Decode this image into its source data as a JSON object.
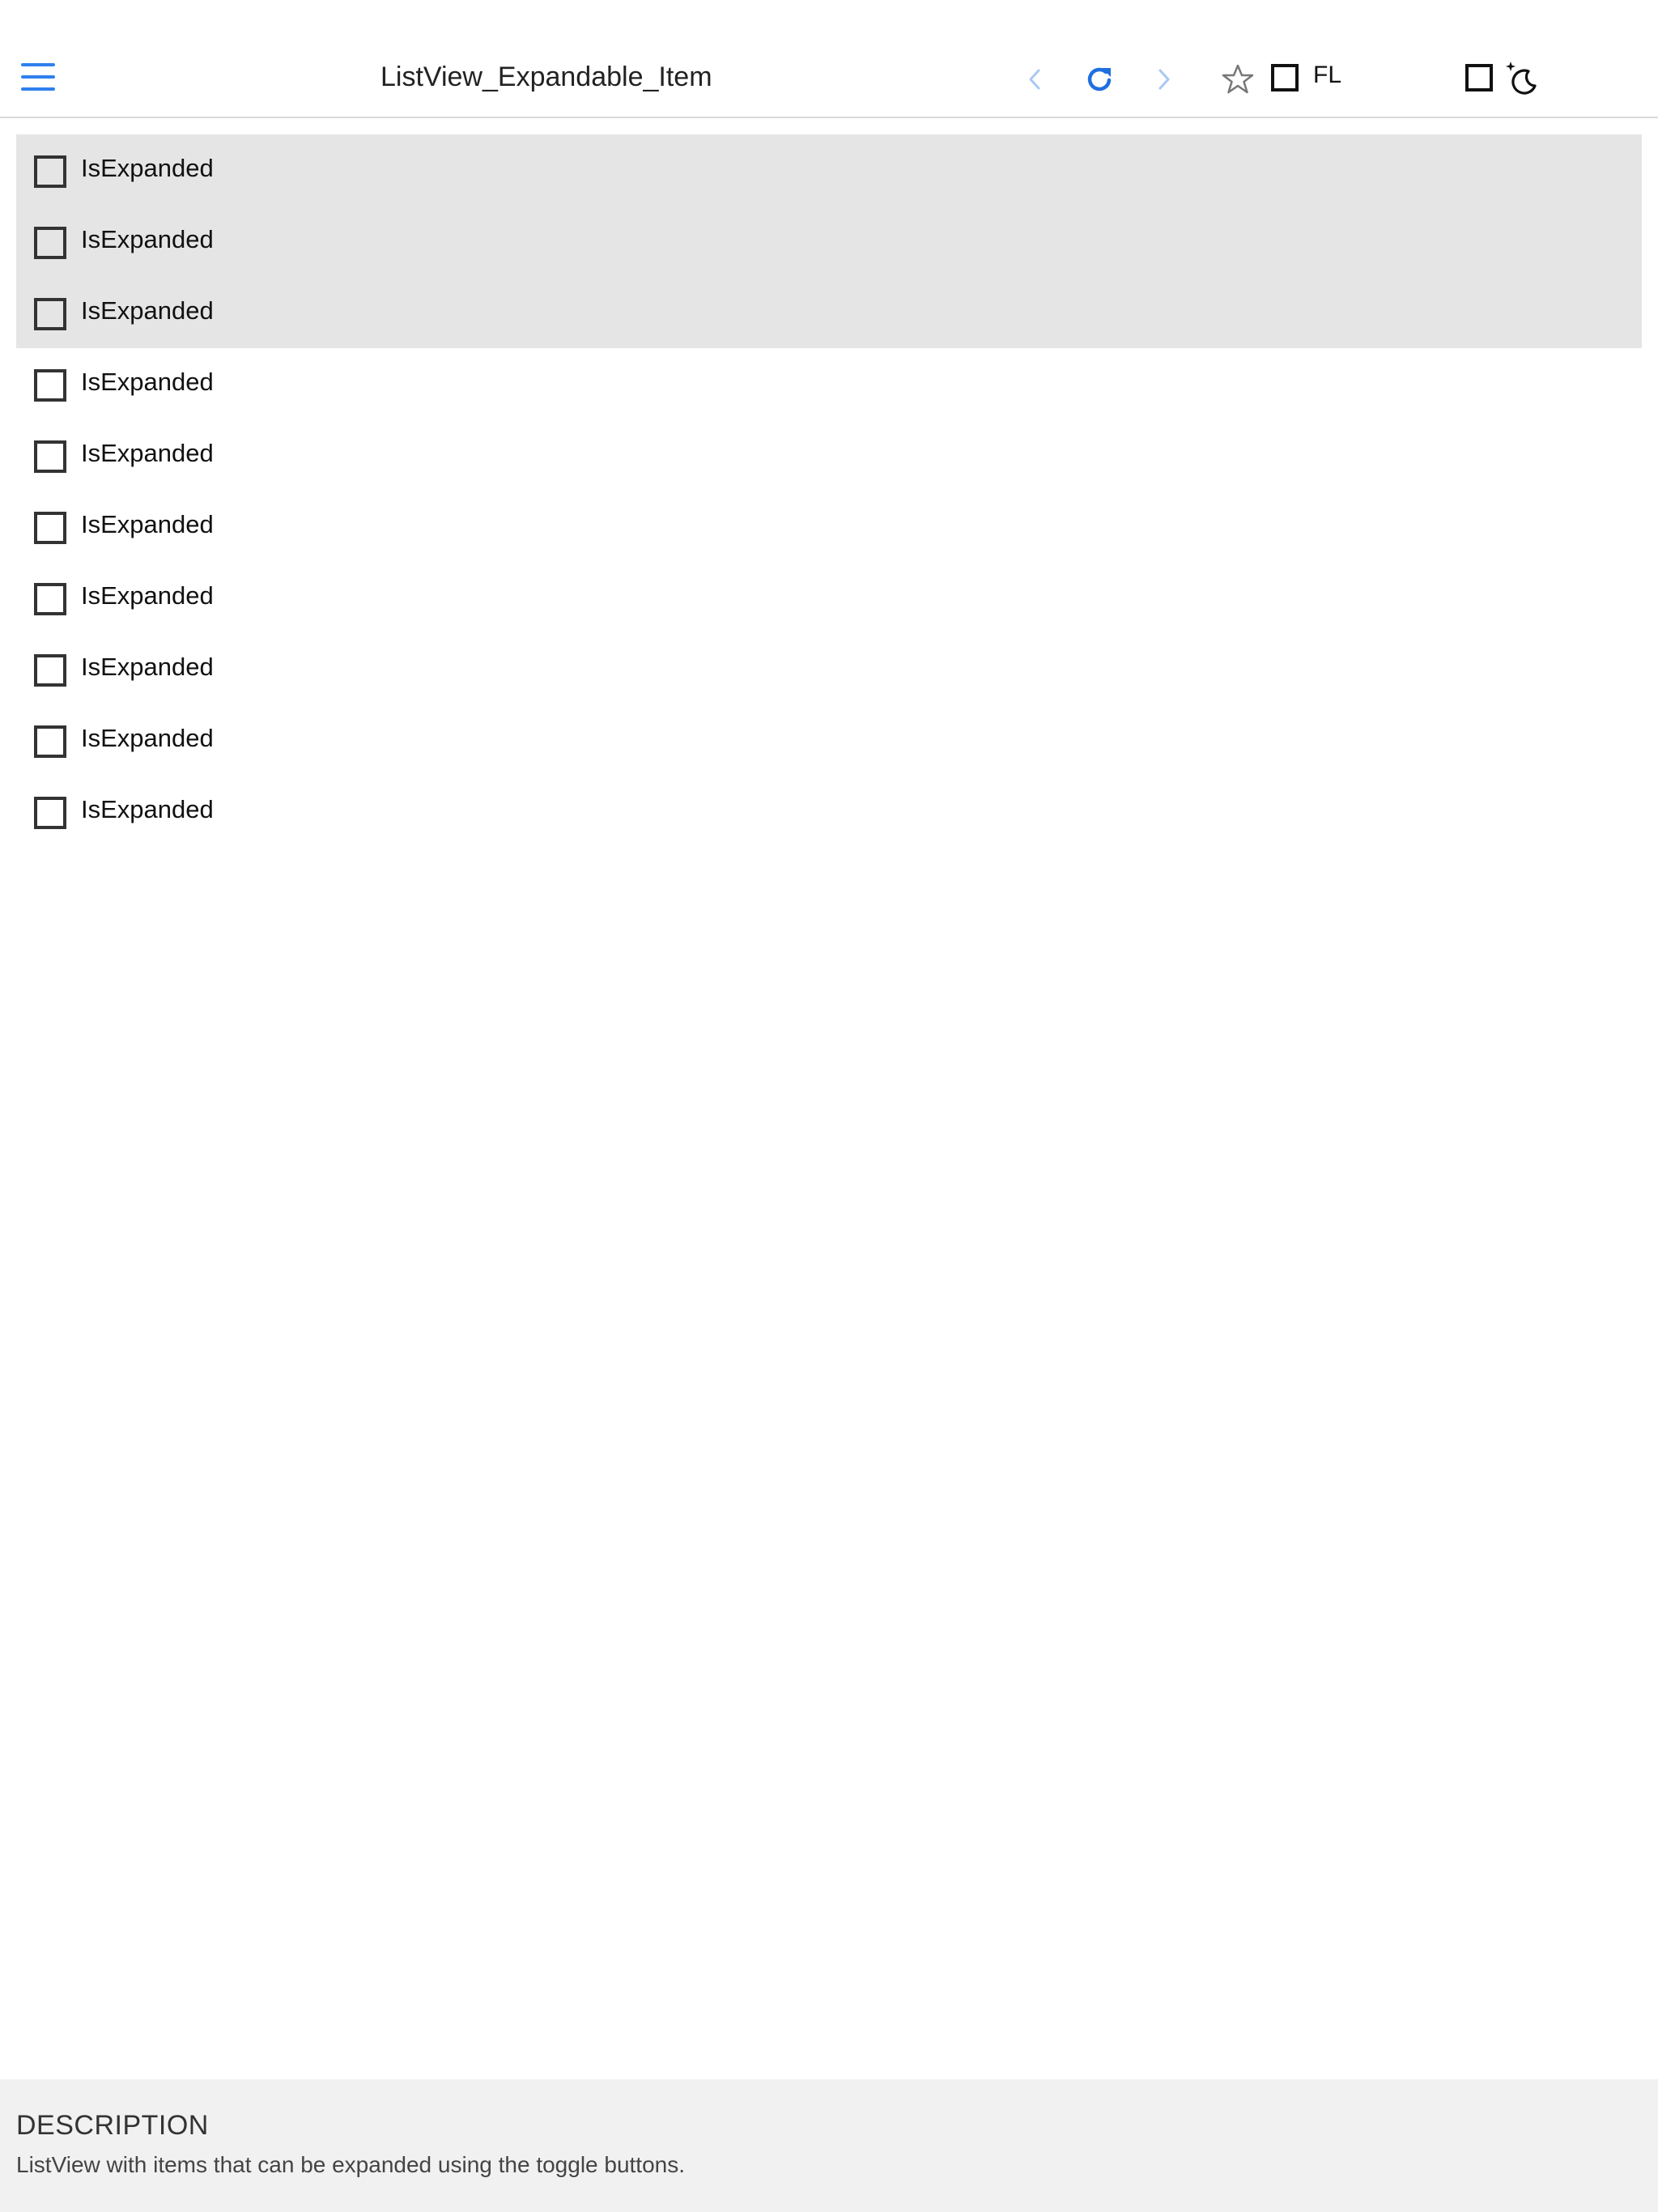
{
  "header": {
    "title": "ListView_Expandable_Item",
    "fl_label": "FL",
    "icons": {
      "menu": "hamburger-menu-icon",
      "back": "chevron-left-icon",
      "refresh": "refresh-icon",
      "forward": "chevron-right-icon",
      "favorite": "star-outline-icon",
      "theme": "moon-sparkle-icon"
    },
    "colors": {
      "accent": "#2f80ed",
      "accent_disabled": "#a9c8f3"
    }
  },
  "list": {
    "items": [
      {
        "label": "IsExpanded",
        "checked": false
      },
      {
        "label": "IsExpanded",
        "checked": false
      },
      {
        "label": "IsExpanded",
        "checked": false
      },
      {
        "label": "IsExpanded",
        "checked": false
      },
      {
        "label": "IsExpanded",
        "checked": false
      },
      {
        "label": "IsExpanded",
        "checked": false
      },
      {
        "label": "IsExpanded",
        "checked": false
      },
      {
        "label": "IsExpanded",
        "checked": false
      },
      {
        "label": "IsExpanded",
        "checked": false
      },
      {
        "label": "IsExpanded",
        "checked": false
      }
    ],
    "shaded_color": "#e5e5e5"
  },
  "description": {
    "title": "DESCRIPTION",
    "text": "ListView with items that can be expanded using the toggle buttons."
  }
}
